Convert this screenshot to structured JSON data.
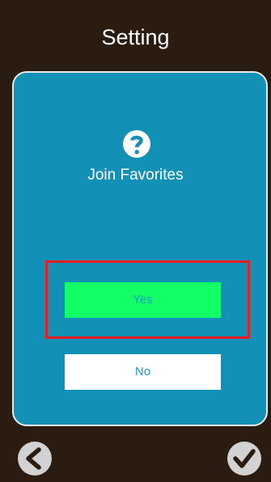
{
  "header": {
    "title": "Setting"
  },
  "dialog": {
    "icon": "question-circle-icon",
    "prompt": "Join Favorites",
    "yes_label": "Yes",
    "no_label": "No",
    "selected": "Yes"
  },
  "footer": {
    "back_icon": "back-chevron-icon",
    "confirm_icon": "check-icon"
  },
  "colors": {
    "background": "#2b1c12",
    "panel": "#1390b6",
    "yes_button": "#12ff66",
    "no_button": "#ffffff",
    "focus_border": "#ec1e24",
    "button_text": "#1e9dc6"
  }
}
